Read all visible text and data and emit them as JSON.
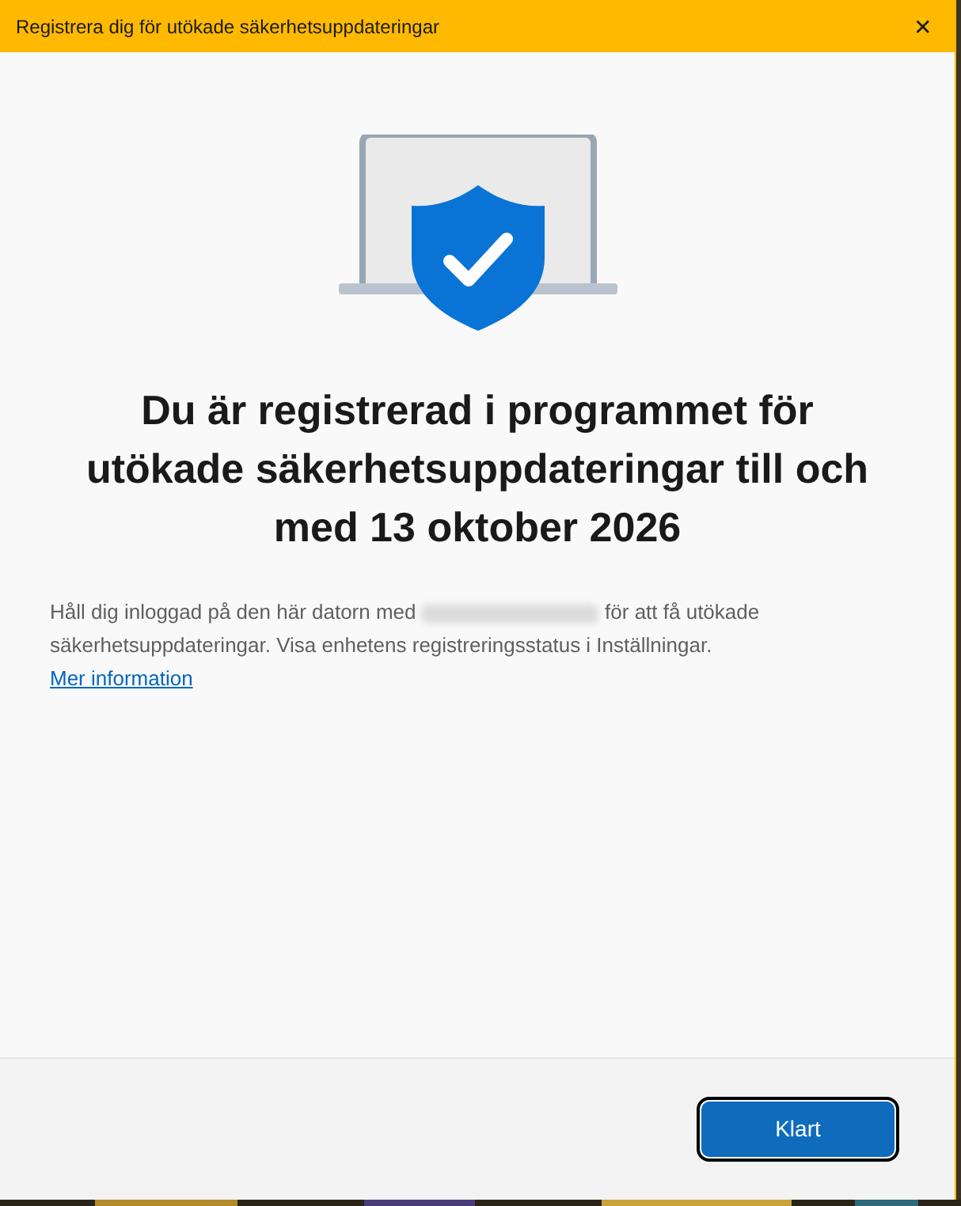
{
  "window": {
    "title": "Registrera dig för utökade säkerhetsuppdateringar",
    "close": "✕"
  },
  "heading": "Du är registrerad i programmet för utökade säkerhetsuppdateringar till och med 13 oktober 2026",
  "message": {
    "before": "Håll dig inloggad på den här datorn med",
    "after": "för att få utökade säkerhetsuppdateringar. Visa enhetens registreringsstatus i Inställningar."
  },
  "link": "Mer information",
  "buttons": [
    {
      "label": "Klart",
      "focused": true
    }
  ]
}
